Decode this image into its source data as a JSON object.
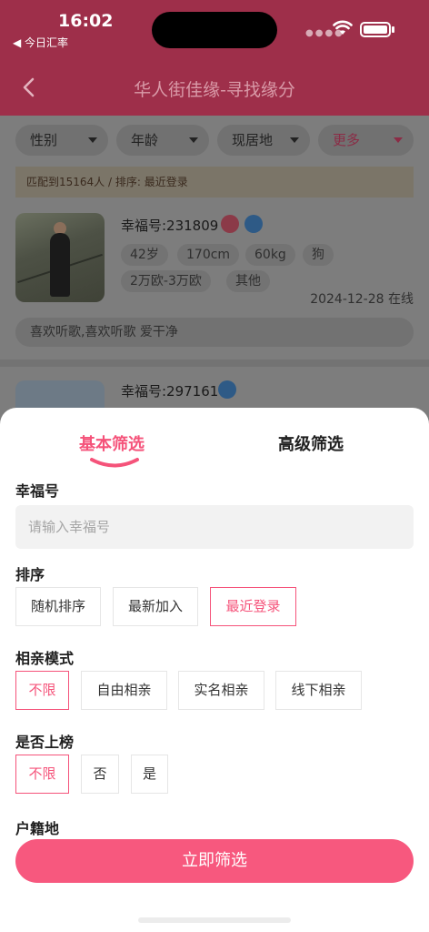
{
  "status_bar": {
    "time": "16:02",
    "back_app": "◀ 今日汇率"
  },
  "nav": {
    "title": "华人街佳缘-寻找缘分"
  },
  "filters": [
    {
      "label": "性别"
    },
    {
      "label": "年龄"
    },
    {
      "label": "现居地"
    },
    {
      "label": "更多"
    }
  ],
  "match_info": "匹配到15164人 / 排序: 最近登录",
  "card1": {
    "id": "幸福号:231809",
    "tags": [
      "42岁",
      "170cm",
      "60kg",
      "狗",
      "2万欧-3万欧",
      "其他"
    ],
    "last_login": "2024-12-28 在线",
    "motto": "喜欢听歌,喜欢听歌 爱干净"
  },
  "card2": {
    "id": "幸福号:297161"
  },
  "sheet": {
    "tabs": {
      "basic": "基本筛选",
      "advanced": "高级筛选"
    },
    "id_section": {
      "label": "幸福号",
      "placeholder": "请输入幸福号",
      "value": ""
    },
    "sort_section": {
      "label": "排序",
      "options": [
        "随机排序",
        "最新加入",
        "最近登录"
      ],
      "selected": "最近登录"
    },
    "mode_section": {
      "label": "相亲模式",
      "options": [
        "不限",
        "自由相亲",
        "实名相亲",
        "线下相亲"
      ],
      "selected": "不限"
    },
    "ranked_section": {
      "label": "是否上榜",
      "options": [
        "不限",
        "否",
        "是"
      ],
      "selected": "不限"
    },
    "hukou_section": {
      "label": "户籍地"
    },
    "apply_label": "立即筛选"
  },
  "colors": {
    "accent": "#f5537a",
    "header": "#9e2f4a"
  }
}
